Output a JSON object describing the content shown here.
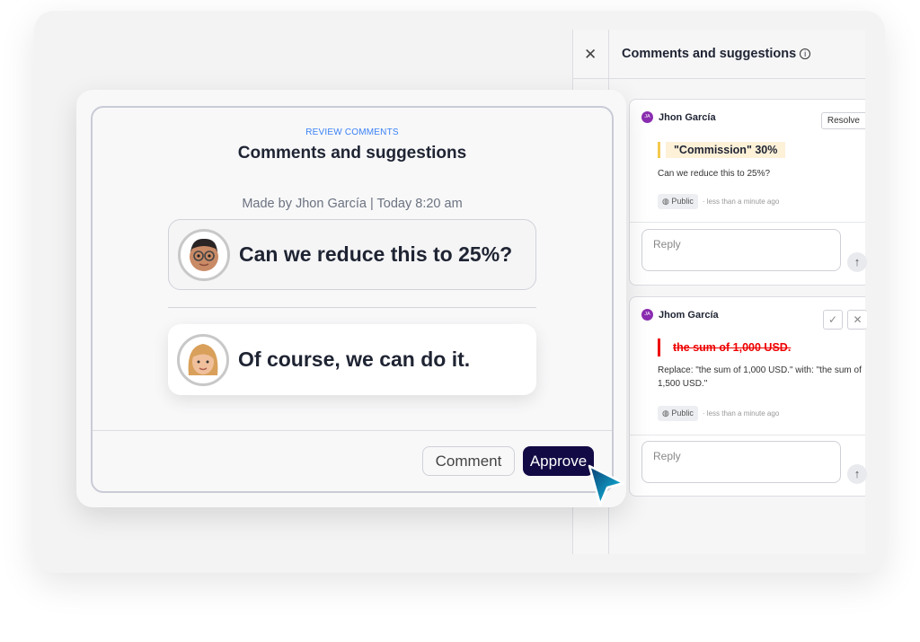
{
  "panel": {
    "title": "Comments and suggestions",
    "comments": [
      {
        "initials": "JA",
        "author": "Jhon García",
        "action": "Resolve",
        "quote": "\"Commission\" 30%",
        "text": "Can we reduce this to 25%?",
        "visibility": "Public",
        "time": "· less than a minute ago",
        "reply_placeholder": "Reply"
      },
      {
        "initials": "JA",
        "author": "Jhom García",
        "quote": "the sum of 1,000 USD.",
        "text": "Replace: \"the sum of 1,000 USD.\" with: \"the sum of 1,500 USD.\"",
        "visibility": "Public",
        "time": "· less than a minute ago",
        "reply_placeholder": "Reply"
      }
    ]
  },
  "modal": {
    "kicker": "REVIEW COMMENTS",
    "title": "Comments and suggestions",
    "made_by": "Made by Jhon García | Today 8:20 am",
    "messages": [
      {
        "text": "Can we reduce this to 25%?"
      },
      {
        "text": "Of course, we can do it."
      }
    ],
    "comment_label": "Comment",
    "approve_label": "Approve"
  },
  "colors": {
    "accent": "#120a45",
    "kicker": "#3b82f6",
    "highlight": "#fdf1d8",
    "strike": "#e00000",
    "avatar": "#8a2db0"
  }
}
